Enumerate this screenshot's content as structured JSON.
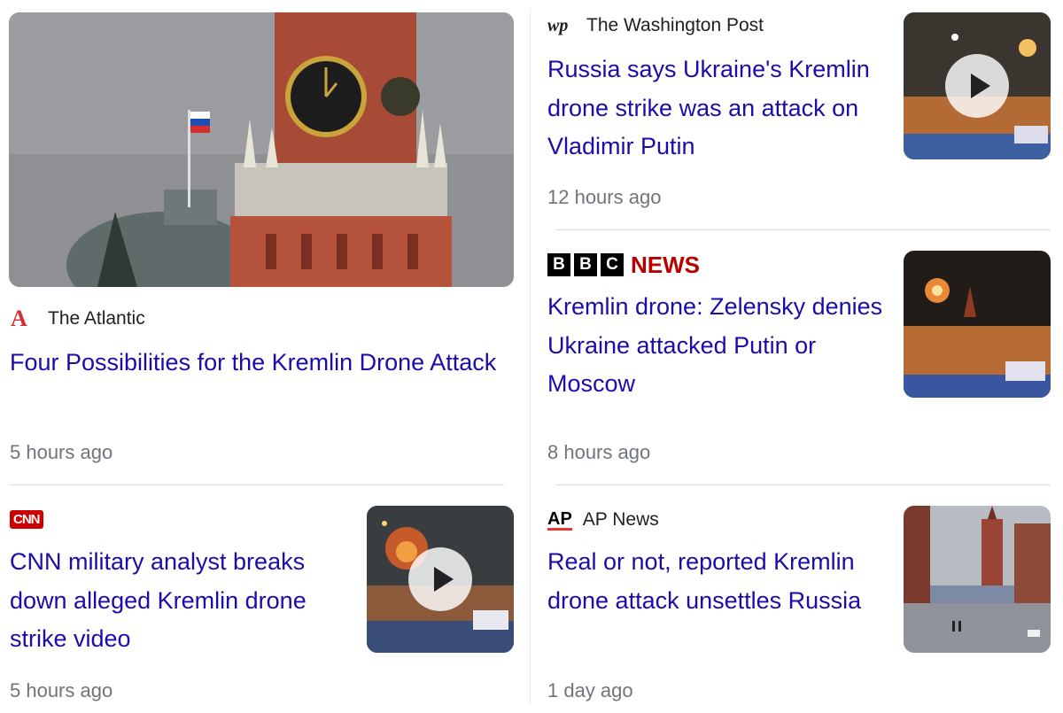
{
  "articles": [
    {
      "source": "The Atlantic",
      "logo_text": "A",
      "title": "Four Possibilities for the Kremlin Drone Attack",
      "time": "5 hours ago",
      "thumb": "kremlin-clock-tower-image"
    },
    {
      "source": "The Washington Post",
      "logo_text": "wp",
      "title": "Russia says Ukraine's Kremlin drone strike was an attack on Vladimir Putin",
      "time": "12 hours ago",
      "thumb": "drone-strike-video-thumbnail",
      "has_video": true
    },
    {
      "source": "",
      "logo_letters": [
        "B",
        "B",
        "C"
      ],
      "logo_text": "NEWS",
      "title": "Kremlin drone: Zelensky denies Ukraine attacked Putin or Moscow",
      "time": "8 hours ago",
      "thumb": "kremlin-night-explosion-image"
    },
    {
      "source": "",
      "logo_text": "CNN",
      "title": "CNN military analyst breaks down alleged Kremlin drone strike video",
      "time": "5 hours ago",
      "thumb": "kremlin-night-video-thumbnail",
      "has_video": true
    },
    {
      "source": "AP News",
      "logo_text": "AP",
      "title": "Real or not, reported Kremlin drone attack unsettles Russia",
      "time": "1 day ago",
      "thumb": "red-square-street-image"
    }
  ],
  "colors": {
    "link": "#1a0dab",
    "time": "#70757a",
    "bbc_news": "#b80000",
    "atlantic": "#d32f2f",
    "cnn": "#cc0000"
  }
}
